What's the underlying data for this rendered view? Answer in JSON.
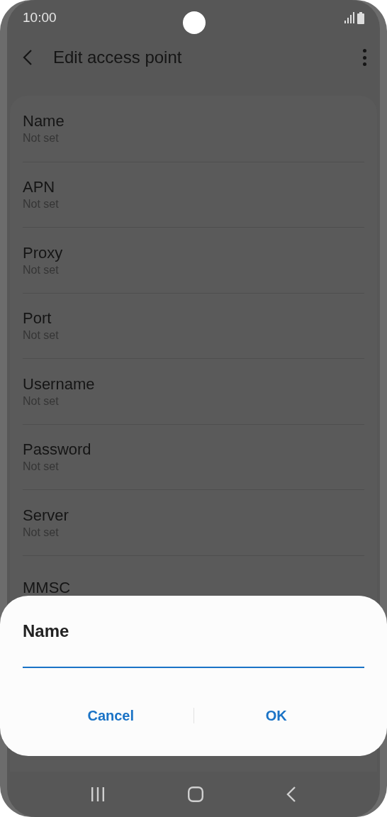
{
  "status_bar": {
    "time": "10:00"
  },
  "app_bar": {
    "title": "Edit access point"
  },
  "settings": [
    {
      "title": "Name",
      "value": "Not set"
    },
    {
      "title": "APN",
      "value": "Not set"
    },
    {
      "title": "Proxy",
      "value": "Not set"
    },
    {
      "title": "Port",
      "value": "Not set"
    },
    {
      "title": "Username",
      "value": "Not set"
    },
    {
      "title": "Password",
      "value": "Not set"
    },
    {
      "title": "Server",
      "value": "Not set"
    },
    {
      "title": "MMSC"
    }
  ],
  "dialog": {
    "title": "Name",
    "buttons": [
      "Cancel",
      "OK"
    ]
  }
}
